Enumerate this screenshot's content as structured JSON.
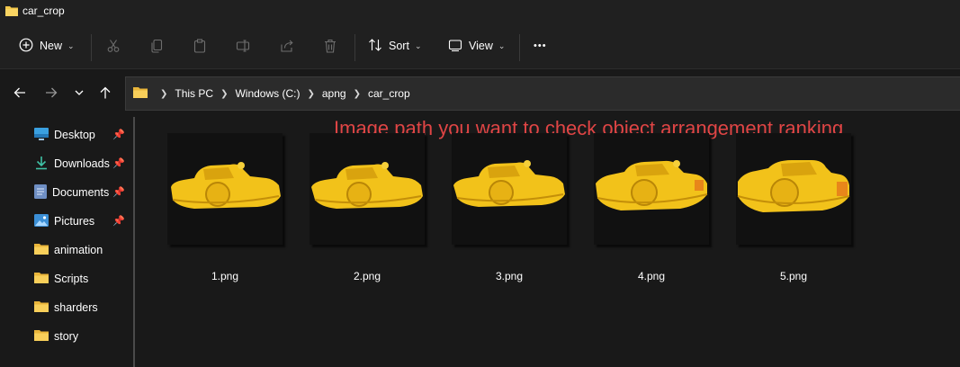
{
  "window": {
    "title": "car_crop"
  },
  "toolbar": {
    "new_label": "New",
    "sort_label": "Sort",
    "view_label": "View",
    "more_label": "•••"
  },
  "address": {
    "crumbs": [
      "This PC",
      "Windows (C:)",
      "apng",
      "car_crop"
    ]
  },
  "sidebar": {
    "items": [
      {
        "label": "Desktop",
        "icon": "desktop-icon",
        "pinned": true
      },
      {
        "label": "Downloads",
        "icon": "download-icon",
        "pinned": true
      },
      {
        "label": "Documents",
        "icon": "document-icon",
        "pinned": true
      },
      {
        "label": "Pictures",
        "icon": "pictures-icon",
        "pinned": true
      },
      {
        "label": "animation",
        "icon": "folder-icon",
        "pinned": false
      },
      {
        "label": "Scripts",
        "icon": "folder-icon",
        "pinned": false
      },
      {
        "label": "sharders",
        "icon": "folder-icon",
        "pinned": false
      },
      {
        "label": "story",
        "icon": "folder-icon",
        "pinned": false
      }
    ]
  },
  "content": {
    "annotation": "Image path you want to check object arrangement ranking",
    "annotation_color": "#e04545",
    "files": [
      {
        "name": "1.png"
      },
      {
        "name": "2.png"
      },
      {
        "name": "3.png"
      },
      {
        "name": "4.png"
      },
      {
        "name": "5.png"
      }
    ]
  },
  "colors": {
    "folder": "#f4c84a",
    "thumbnail_object": "#f2c21a"
  }
}
